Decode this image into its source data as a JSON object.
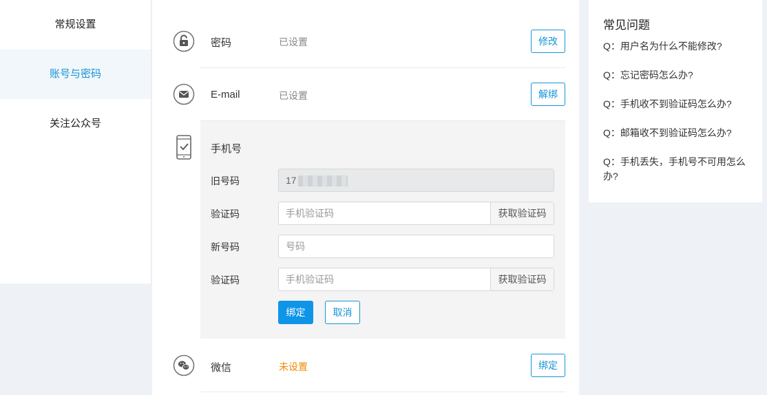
{
  "sidebar": {
    "items": [
      {
        "label": "常规设置",
        "active": false
      },
      {
        "label": "账号与密码",
        "active": true
      },
      {
        "label": "关注公众号",
        "active": false
      }
    ]
  },
  "main": {
    "password": {
      "icon": "lock-icon",
      "title": "密码",
      "status": "已设置",
      "action": "修改"
    },
    "email": {
      "icon": "envelope-icon",
      "title": "E-mail",
      "status": "已设置",
      "action": "解绑"
    },
    "phone": {
      "icon": "phone-check-icon",
      "title": "手机号",
      "old_label": "旧号码",
      "old_value": "17",
      "code_label_1": "验证码",
      "code_placeholder_1": "手机验证码",
      "code_button_1": "获取验证码",
      "new_label": "新号码",
      "new_placeholder": "号码",
      "code_label_2": "验证码",
      "code_placeholder_2": "手机验证码",
      "code_button_2": "获取验证码",
      "bind_button": "绑定",
      "cancel_button": "取消"
    },
    "wechat": {
      "icon": "wechat-icon",
      "title": "微信",
      "status": "未设置",
      "action": "绑定"
    }
  },
  "faq": {
    "title": "常见问题",
    "items": [
      "Q：用户名为什么不能修改?",
      "Q：忘记密码怎么办?",
      "Q：手机收不到验证码怎么办?",
      "Q：邮箱收不到验证码怎么办?",
      "Q：手机丢失，手机号不可用怎么办?"
    ]
  },
  "colors": {
    "accent": "#1593d6",
    "primary_button": "#0f95e8",
    "warning": "#f28a00",
    "background": "#eef2f6"
  }
}
